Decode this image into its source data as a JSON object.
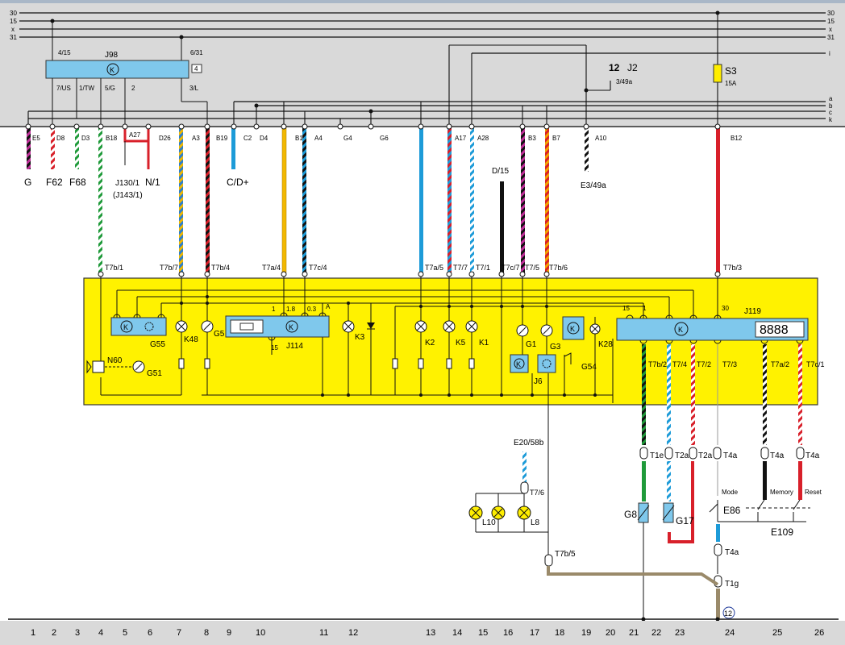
{
  "rails": {
    "left": [
      "30",
      "15",
      "x",
      "31"
    ],
    "right": [
      "30",
      "15",
      "x",
      "31"
    ],
    "bus_right": [
      "i",
      "a",
      "b",
      "c",
      "k"
    ]
  },
  "top_modules": {
    "j98": {
      "name": "J98",
      "pins_top": [
        "4/15",
        "6/31"
      ],
      "pins_bottom": [
        "7/US",
        "1/TW",
        "5/G",
        "2",
        "3/L"
      ],
      "box_num": "4"
    },
    "j2": {
      "name": "J2",
      "num": "12",
      "pin": "3/49a"
    },
    "s3": {
      "name": "S3",
      "rating": "15A"
    }
  },
  "connector_labels": [
    "E5",
    "D8",
    "D3",
    "B18",
    "A27",
    "D26",
    "A3",
    "B19",
    "C2",
    "D4",
    "B15",
    "A4",
    "G4",
    "G6",
    "A17",
    "A28",
    "B3",
    "B7",
    "A10",
    "B12"
  ],
  "component_labels": {
    "g": "G",
    "f62": "F62",
    "f68": "F68",
    "j130": "J130/1",
    "j143": "(J143/1)",
    "n1": "N/1",
    "cd": "C/D+",
    "d15": "D/15",
    "e349": "E3/49a"
  },
  "t_labels_top": [
    "T7b/1",
    "T7b/7",
    "T7b/4",
    "T7a/4",
    "T7c/4",
    "T7a/5",
    "T7/7",
    "T7/1",
    "T7c/7",
    "T7/5",
    "T7b/6",
    "T7b/3"
  ],
  "cluster": {
    "name": "J119",
    "pins_top": [
      "15",
      "1",
      "30"
    ],
    "j114": {
      "name": "J114",
      "pins": [
        "1",
        "1.8",
        "0.3",
        "A",
        "15"
      ]
    },
    "components": [
      "G55",
      "G51",
      "N60",
      "K48",
      "G5",
      "K3",
      "K2",
      "K5",
      "K1",
      "G1",
      "G3",
      "K28",
      "G54",
      "J6"
    ],
    "display": "8888"
  },
  "t_labels_bottom": [
    "T7b/2",
    "T7/4",
    "T7/2",
    "T7/3",
    "T7a/2",
    "T7c/1"
  ],
  "right_section": {
    "t_connectors": [
      "T1e",
      "T2a",
      "T2a",
      "T4a",
      "T4a",
      "T4a"
    ],
    "switch_labels": [
      "Mode",
      "Memory",
      "Reset"
    ],
    "e86": "E86",
    "e109": "E109",
    "t4a_lower": "T4a",
    "t1g": "T1g",
    "g8": "G8",
    "g17": "G17",
    "ground_num": "12"
  },
  "lower_left": {
    "e20": "E20/58b",
    "t76": "T7/6",
    "l10": "L10",
    "l8": "L8",
    "t7b5": "T7b/5"
  },
  "ruler": [
    "1",
    "2",
    "3",
    "4",
    "5",
    "6",
    "7",
    "8",
    "9",
    "10",
    "11",
    "12",
    "13",
    "14",
    "15",
    "16",
    "17",
    "18",
    "19",
    "20",
    "21",
    "22",
    "23",
    "24",
    "25",
    "26"
  ]
}
